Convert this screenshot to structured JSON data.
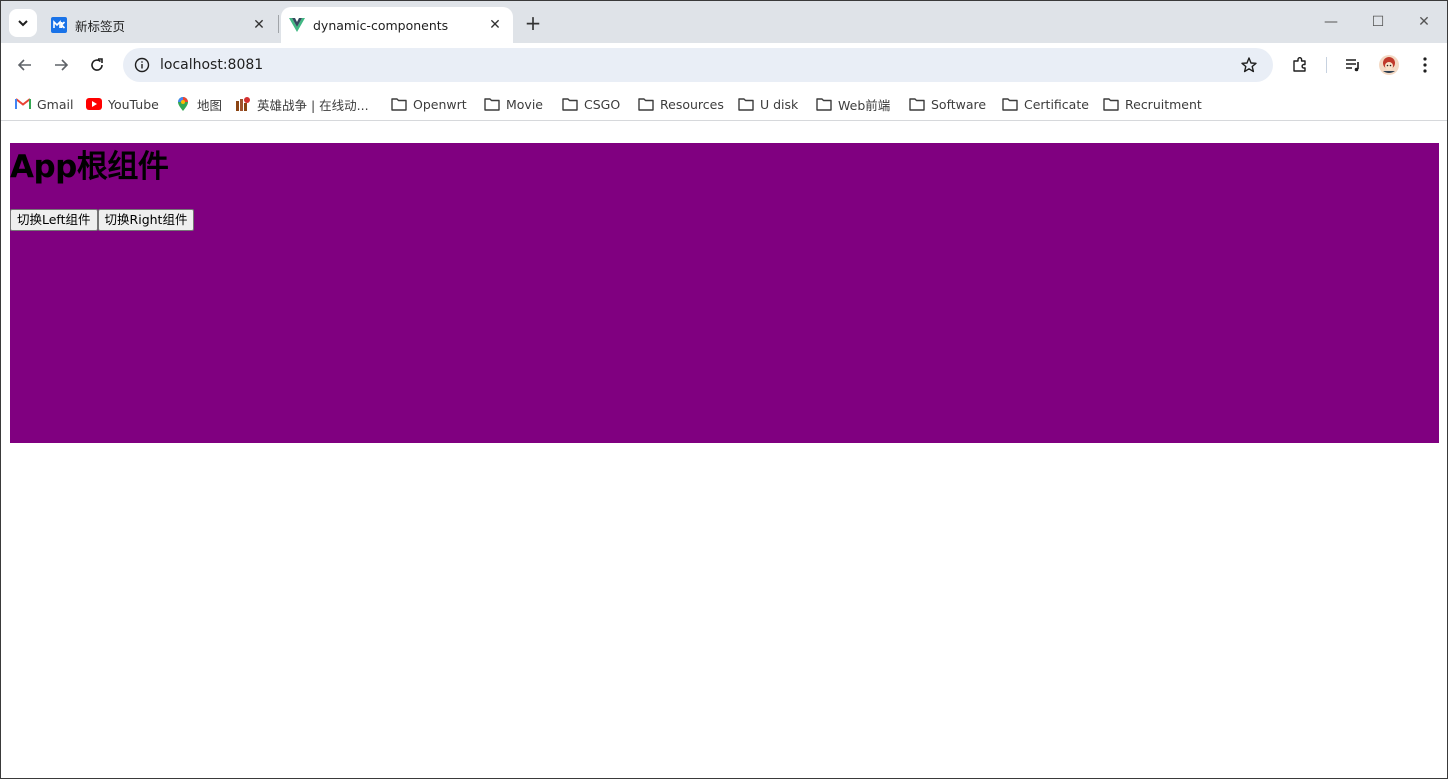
{
  "browser": {
    "tabs": [
      {
        "title": "新标签页",
        "favicon": "new-tab-favicon",
        "active": false
      },
      {
        "title": "dynamic-components",
        "favicon": "vue-favicon",
        "active": true
      }
    ],
    "close_glyph": "✕",
    "new_tab_glyph": "+",
    "window_controls": {
      "minimize": "—",
      "maximize": "☐",
      "close": "✕"
    },
    "url": "localhost:8081",
    "bookmarks": [
      {
        "label": "Gmail",
        "icon": "gmail-icon"
      },
      {
        "label": "YouTube",
        "icon": "youtube-icon"
      },
      {
        "label": "地图",
        "icon": "maps-icon"
      },
      {
        "label": "英雄战争 | 在线动...",
        "icon": "game-icon"
      },
      {
        "label": "Openwrt",
        "icon": "folder-icon"
      },
      {
        "label": "Movie",
        "icon": "folder-icon"
      },
      {
        "label": "CSGO",
        "icon": "folder-icon"
      },
      {
        "label": "Resources",
        "icon": "folder-icon"
      },
      {
        "label": "U disk",
        "icon": "folder-icon"
      },
      {
        "label": "Web前端",
        "icon": "folder-icon"
      },
      {
        "label": "Software",
        "icon": "folder-icon"
      },
      {
        "label": "Certificate",
        "icon": "folder-icon"
      },
      {
        "label": "Recruitment",
        "icon": "folder-icon"
      }
    ]
  },
  "app": {
    "title": "App根组件",
    "background_color": "#800080",
    "buttons": {
      "left": "切换Left组件",
      "right": "切换Right组件"
    }
  }
}
